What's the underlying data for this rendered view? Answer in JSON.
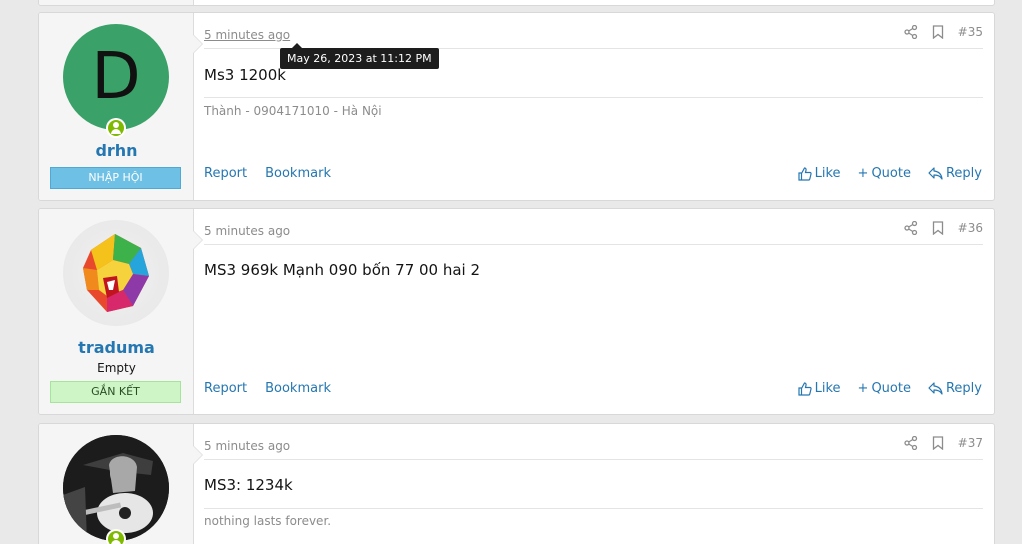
{
  "posts": [
    {
      "username": "drhn",
      "avatar_letter": "D",
      "avatar_color": "#3aa268",
      "banner": "NHẬP HỘI",
      "time": "5 minutes ago",
      "tooltip": "May 26, 2023 at 11:12 PM",
      "number": "#35",
      "message": "Ms3 1200k",
      "signature": "Thành - 0904171010 - Hà Nội",
      "online": true
    },
    {
      "username": "traduma",
      "user_title": "Empty",
      "banner": "GẮN KẾT",
      "time": "5 minutes ago",
      "number": "#36",
      "message": "MS3 969k Mạnh 090 bốn 77 00 hai 2",
      "online": false
    },
    {
      "time": "5 minutes ago",
      "number": "#37",
      "message": "MS3: 1234k",
      "signature": "nothing lasts forever.",
      "online": true
    }
  ],
  "actions": {
    "report": "Report",
    "bookmark": "Bookmark",
    "like": "Like",
    "quote": "Quote",
    "reply": "Reply"
  },
  "colors": {
    "link": "#2577b1",
    "online": "#7fb900",
    "banner_blue": "#6ec0e4",
    "banner_green": "#cdf5c6"
  },
  "icons": [
    "share-icon",
    "bookmark-icon",
    "like-icon",
    "quote-plus-icon",
    "reply-icon",
    "online-user-icon"
  ]
}
